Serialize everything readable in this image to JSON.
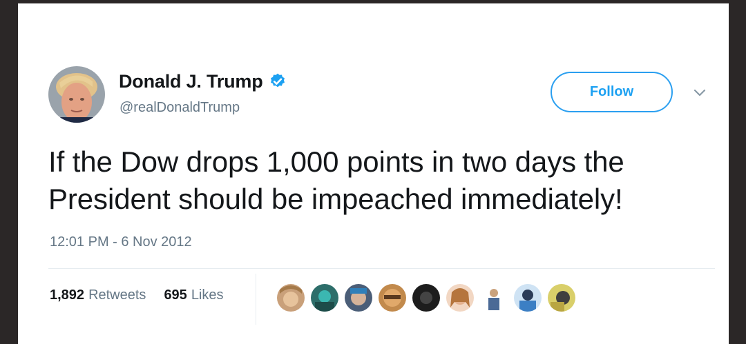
{
  "tweet": {
    "author_name": "Donald J. Trump",
    "author_handle": "@realDonaldTrump",
    "verified": true,
    "follow_label": "Follow",
    "text_line1": "If the Dow drops 1,000 points in two days the",
    "text_line2": "President should be impeached immediately!",
    "timestamp": "12:01 PM - 6 Nov 2012",
    "retweets_count": "1,892",
    "retweets_label": "Retweets",
    "likes_count": "695",
    "likes_label": "Likes"
  },
  "colors": {
    "accent": "#1da1f2",
    "text": "#14171a",
    "muted": "#657786"
  },
  "icons": {
    "verified": "verified-badge-icon",
    "caret": "chevron-down-icon"
  }
}
